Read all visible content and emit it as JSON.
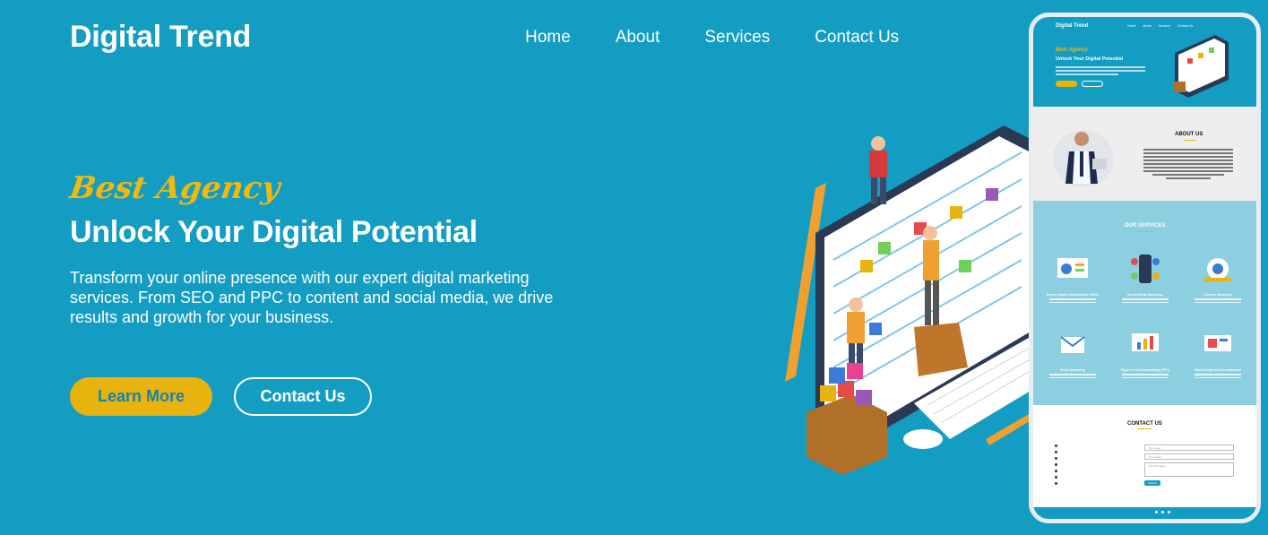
{
  "header": {
    "logo": "Digital Trend",
    "nav": [
      "Home",
      "About",
      "Services",
      "Contact Us"
    ]
  },
  "hero": {
    "tagline": "Best Agency",
    "headline": "Unlock Your Digital Potential",
    "description": "Transform your online presence with our expert digital marketing services. From SEO and PPC to content and social media, we drive results and growth for your business.",
    "primary_button": "Learn More",
    "secondary_button": "Contact Us"
  },
  "mockup": {
    "logo": "Digital Trend",
    "nav": [
      "Home",
      "About",
      "Services",
      "Contact Us"
    ],
    "tagline": "Best Agency",
    "headline": "Unlock Your Digital Potential",
    "about_title": "ABOUT US",
    "services_title": "OUR SERVICES",
    "services": [
      "Search Engine Optimization (SEO)",
      "Social Media Marketing",
      "Content Marketing",
      "Email Marketing",
      "Pay-Per-Click Advertising (PPC)",
      "Web Design and Development"
    ],
    "contact_title": "CONTACT US",
    "contact_fields": [
      "Your name",
      "Your Email",
      "Your Message"
    ],
    "submit": "Submit"
  },
  "colors": {
    "background": "#139dc3",
    "accent": "#e8b30d",
    "text": "#ffffff"
  }
}
